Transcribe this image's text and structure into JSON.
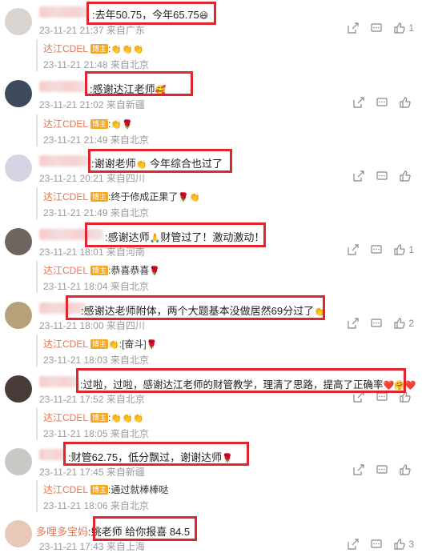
{
  "comments": [
    {
      "text": ":去年50.75，今年65.75",
      "emoji": "😆",
      "time": "23-11-21 21:37 来自广东",
      "like_count": "1",
      "reply": {
        "name": "达江CDEL",
        "badge": "博主",
        "text": ":",
        "emoji": "👏👏👏",
        "time": "23-11-21 21:48 来自北京"
      }
    },
    {
      "text": ":感谢达江老师",
      "emoji": "🥰",
      "time": "23-11-21 21:02 来自新疆",
      "like_count": "",
      "reply": {
        "name": "达江CDEL",
        "badge": "博主",
        "text": ":",
        "emoji": "👏🌹",
        "time": "23-11-21 21:49 来自北京"
      }
    },
    {
      "text": ":谢谢老师",
      "text2": " 今年综合也过了",
      "emoji": "👏",
      "time": "23-11-21 20:21 来自四川",
      "like_count": "",
      "reply": {
        "name": "达江CDEL",
        "badge": "博主",
        "text": ":终于修成正果了",
        "emoji": "🌹👏",
        "time": "23-11-21 21:49 来自北京"
      }
    },
    {
      "text": ":感谢达师",
      "text2": "财管过了！激动激动！",
      "emoji": "🙏",
      "time": "23-11-21 18:01 来自河南",
      "like_count": "1",
      "reply": {
        "name": "达江CDEL",
        "badge": "博主",
        "text": ":恭喜恭喜",
        "emoji": "🌹",
        "time": "23-11-21 18:04 来自北京"
      }
    },
    {
      "text": ":感谢达老师附体，两个大题基本没做居然69分过了",
      "emoji": "👏",
      "time": "23-11-21 18:00 来自四川",
      "like_count": "2",
      "reply": {
        "name": "达江CDEL",
        "badge": "博主",
        "text": ":[奋斗]",
        "emoji": "👏🌹",
        "time": "23-11-21 18:03 来自北京"
      }
    },
    {
      "text": ":过啦，过啦，感谢达江老师的财管教学，理清了思路，提高了正确率",
      "emoji": "❤️🤗❤️",
      "time": "23-11-21 17:52 来自北京",
      "like_count": "",
      "reply": {
        "name": "达江CDEL",
        "badge": "博主",
        "text": ":",
        "emoji": "👏👏👏",
        "time": "23-11-21 18:05 来自北京"
      }
    },
    {
      "text": ":财管62.75，低分飘过，谢谢达师",
      "emoji": "🌹",
      "time": "23-11-21 17:45 来自新疆",
      "like_count": "",
      "reply": {
        "name": "达江CDEL",
        "badge": "博主",
        "text": ":通过就棒棒哒",
        "emoji": "",
        "time": "23-11-21 18:06 来自北京"
      }
    },
    {
      "user": "多哩多宝妈",
      "text": ":姚老师 给你报喜 84.5",
      "emoji": "",
      "time": "23-11-21 17:43 来自上海",
      "like_count": "3",
      "reply": null
    }
  ],
  "colors": {
    "accent": "#eb7350",
    "badge": "#f5a623",
    "highlight": "#e0252e"
  }
}
